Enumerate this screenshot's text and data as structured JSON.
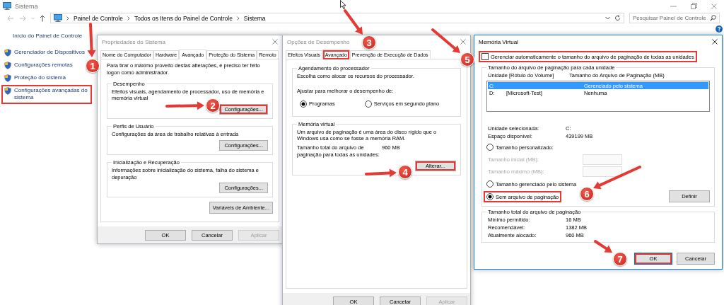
{
  "window": {
    "title": "Sistema"
  },
  "address_bar": {
    "breadcrumb": [
      "Painel de Controle",
      "Todos os Itens do Painel de Controle",
      "Sistema"
    ]
  },
  "search": {
    "placeholder": "Pesquisar Painel de Controle"
  },
  "sidebar": {
    "home": "Início do Painel de Controle",
    "items": [
      {
        "label": "Gerenciador de Dispositivos",
        "highlighted": false
      },
      {
        "label": "Configurações remotas",
        "highlighted": false
      },
      {
        "label": "Proteção do sistema",
        "highlighted": false
      },
      {
        "label": "Configurações avançadas do sistema",
        "highlighted": true
      }
    ]
  },
  "system_properties": {
    "title": "Propriedades do Sistema",
    "active": false,
    "tabs": [
      {
        "label": "Nome do Computador",
        "selected": false
      },
      {
        "label": "Hardware",
        "selected": false
      },
      {
        "label": "Avançado",
        "selected": true
      },
      {
        "label": "Proteção do Sistema",
        "selected": false
      },
      {
        "label": "Remoto",
        "selected": false
      }
    ],
    "notice": "Para tirar o máximo proveito destas alterações, é preciso ter feito logon como administrador.",
    "groups": [
      {
        "title": "Desempenho",
        "description": "Efeitos visuais, agendamento de processador, uso de memória e memória virtual",
        "button": "Configurações...",
        "highlighted": true
      },
      {
        "title": "Perfis de Usuário",
        "description": "Configurações da área de trabalho relativas à entrada",
        "button": "Configurações...",
        "highlighted": false
      },
      {
        "title": "Inicialização e Recuperação",
        "description": "Informações sobre inicialização do sistema, falha do sistema e depuração",
        "button": "Configurações...",
        "highlighted": false
      }
    ],
    "environment_button": "Variáveis de Ambiente...",
    "buttons": [
      {
        "label": "OK",
        "disabled": false
      },
      {
        "label": "Cancelar",
        "disabled": false
      },
      {
        "label": "Aplicar",
        "disabled": true
      }
    ]
  },
  "performance_options": {
    "title": "Opções de Desempenho",
    "active": false,
    "tabs": [
      {
        "label": "Efeitos Visuais",
        "selected": false,
        "highlighted": false
      },
      {
        "label": "Avançado",
        "selected": true,
        "highlighted": true
      },
      {
        "label": "Prevenção de Execução de Dados",
        "selected": false,
        "highlighted": false
      }
    ],
    "scheduling": {
      "title": "Agendamento do processador",
      "description": "Escolha como alocar os recursos do processador.",
      "prompt": "Ajustar para melhorar o desempenho de:",
      "options": [
        {
          "label": "Programas",
          "selected": true
        },
        {
          "label": "Serviços em segundo plano",
          "selected": false
        }
      ]
    },
    "virtual_memory": {
      "title": "Memória virtual",
      "description": "Um arquivo de paginação é uma área do disco rígido que o Windows usa como se fosse a memória RAM.",
      "total_label": "Tamanho total do arquivo de paginação para todas as unidades:",
      "total_value": "960 MB",
      "button": "Alterar...",
      "highlighted": true
    },
    "buttons": [
      {
        "label": "OK",
        "disabled": false
      },
      {
        "label": "Cancelar",
        "disabled": false
      },
      {
        "label": "Aplicar",
        "disabled": true
      }
    ]
  },
  "virtual_memory": {
    "title": "Memória Virtual",
    "active": true,
    "auto_manage": {
      "label": "Gerenciar automaticamente o tamanho do arquivo de paginação de todas as unidades",
      "checked": false,
      "highlighted": true
    },
    "drives": {
      "title": "Tamanho do arquivo de paginação para cada unidade",
      "columns": [
        "Unidade [Rótulo do Volume]",
        "Tamanho do Arquivo de Paginação (MB)"
      ],
      "rows": [
        {
          "drive": "C:",
          "size": "Gerenciado pelo sistema",
          "selected": true
        },
        {
          "drive": "D:",
          "volume": "[Microsoft-Test]",
          "size": "Nenhuma",
          "selected": false
        }
      ],
      "info": [
        {
          "label": "Unidade selecionada:",
          "value": "C:"
        },
        {
          "label": "Espaço disponível:",
          "value": "439199 MB"
        }
      ],
      "size_options": [
        {
          "label": "Tamanho personalizado:",
          "selected": false,
          "highlighted": false,
          "fields": [
            {
              "label": "Tamanho inicial (MB):",
              "disabled": true
            },
            {
              "label": "Tamanho máximo (MB):",
              "disabled": true
            }
          ]
        },
        {
          "label": "Tamanho gerenciado pelo sistema",
          "selected": false,
          "highlighted": false
        },
        {
          "label": "Sem arquivo de paginação",
          "selected": true,
          "highlighted": true
        }
      ],
      "set_button": "Definir"
    },
    "totals": {
      "title": "Tamanho total do arquivo de paginação",
      "rows": [
        {
          "label": "Mínimo permitido:",
          "value": "16 MB"
        },
        {
          "label": "Recomendável:",
          "value": "1382 MB"
        },
        {
          "label": "Atualmente alocado:",
          "value": "960 MB"
        }
      ]
    },
    "buttons": [
      {
        "label": "OK",
        "focused": true,
        "highlighted": true
      },
      {
        "label": "Cancelar",
        "focused": false,
        "highlighted": false
      }
    ]
  },
  "annotations": [
    {
      "label": "1"
    },
    {
      "label": "2"
    },
    {
      "label": "3"
    },
    {
      "label": "4"
    },
    {
      "label": "5"
    },
    {
      "label": "6"
    },
    {
      "label": "7"
    }
  ]
}
